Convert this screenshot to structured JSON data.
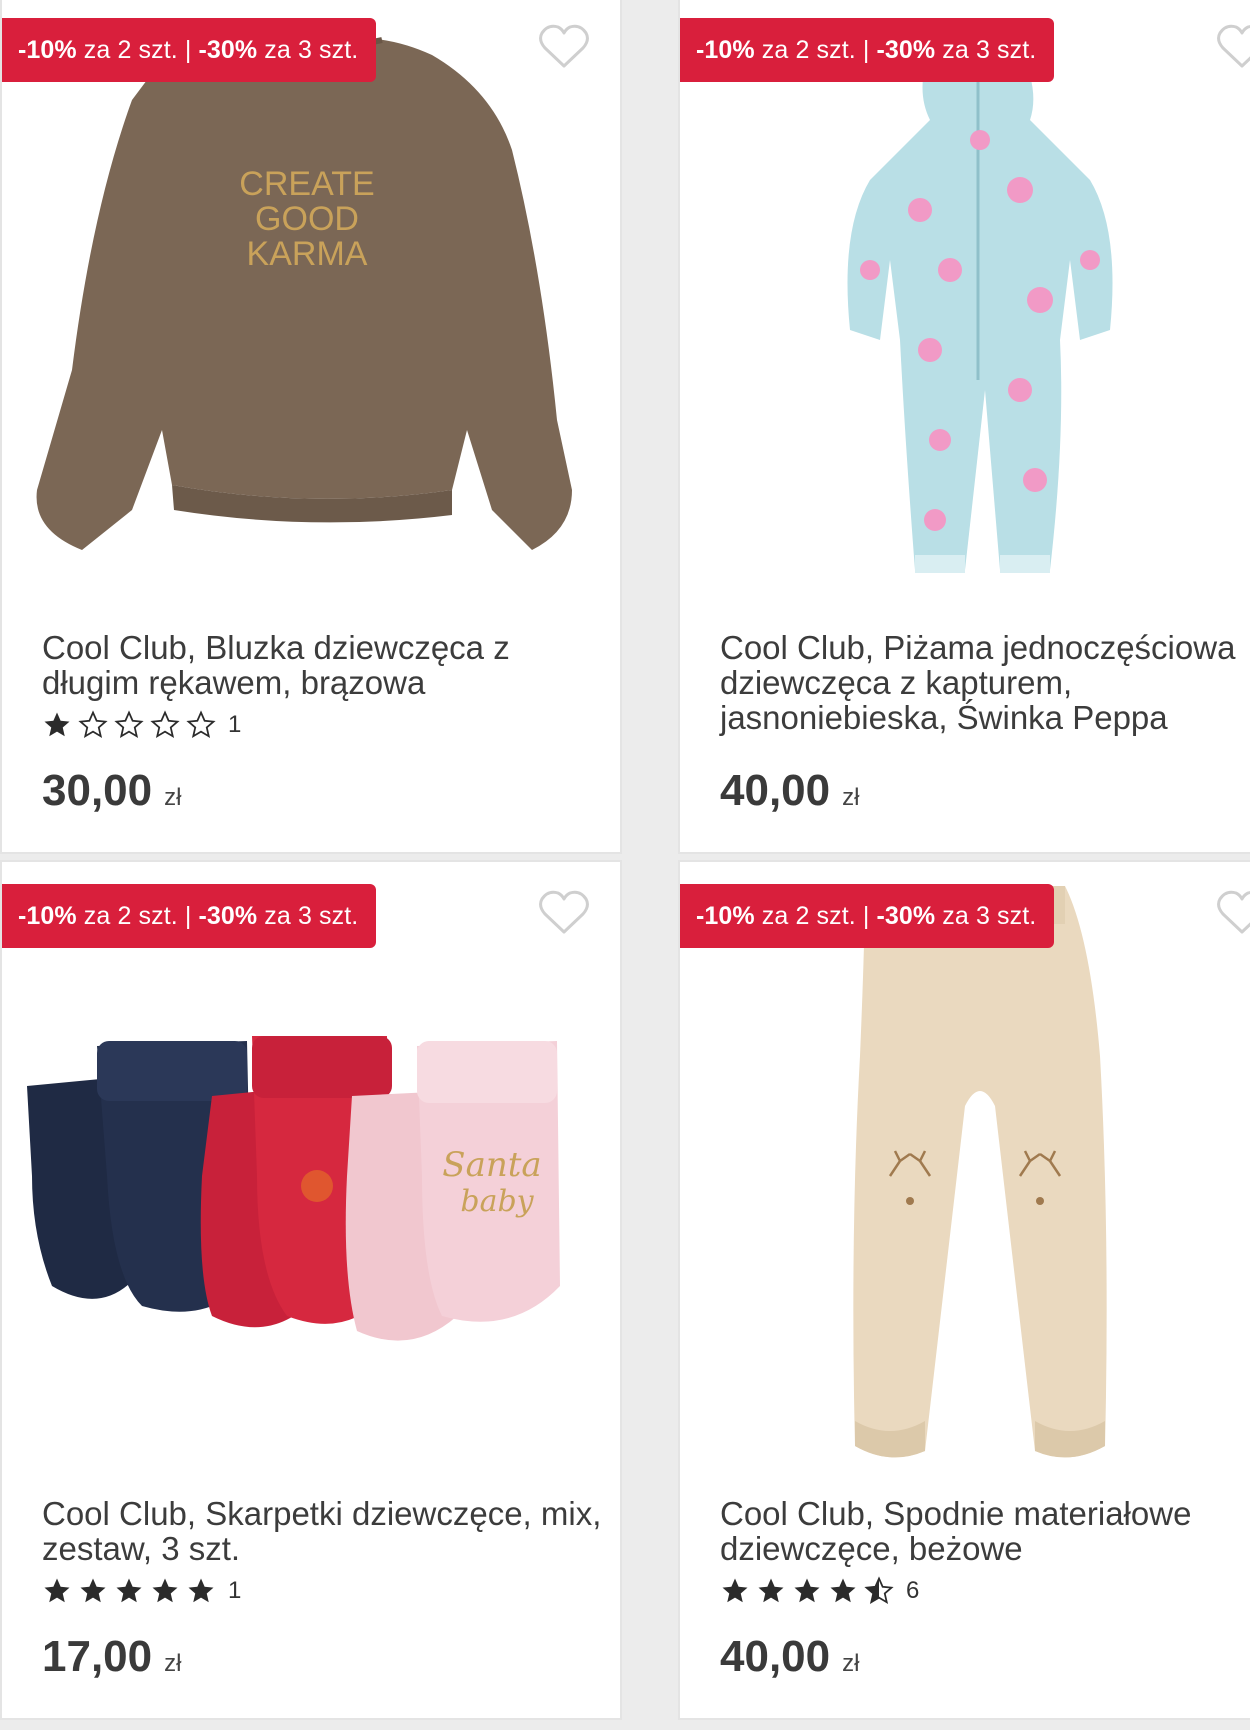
{
  "products": [
    {
      "promo_part1": "-10%",
      "promo_part2": " za 2 szt. | ",
      "promo_part3": "-30%",
      "promo_part4": " za 3 szt.",
      "title": "Cool Club, Bluzka dziewczęca z długim rękawem, brązowa",
      "image_text": [
        "CREATE",
        "GOOD",
        "KARMA"
      ],
      "rating": 1,
      "rating_count": "1",
      "price": "30,00",
      "currency": "zł"
    },
    {
      "promo_part1": "-10%",
      "promo_part2": " za 2 szt. | ",
      "promo_part3": "-30%",
      "promo_part4": " za 3 szt.",
      "title": "Cool Club, Piżama jednoczęściowa dziewczęca z kapturem, jasnoniebieska, Świnka Peppa",
      "price": "40,00",
      "currency": "zł"
    },
    {
      "promo_part1": "-10%",
      "promo_part2": " za 2 szt. | ",
      "promo_part3": "-30%",
      "promo_part4": " za 3 szt.",
      "title": "Cool Club, Skarpetki dziewczęce, mix, zestaw, 3 szt.",
      "image_text": [
        "Santa",
        "baby"
      ],
      "rating": 5,
      "rating_count": "1",
      "price": "17,00",
      "currency": "zł"
    },
    {
      "promo_part1": "-10%",
      "promo_part2": " za 2 szt. | ",
      "promo_part3": "-30%",
      "promo_part4": " za 3 szt.",
      "title": "Cool Club, Spodnie materiałowe dziewczęce, beżowe",
      "rating": 4.5,
      "rating_count": "6",
      "price": "40,00",
      "currency": "zł"
    }
  ],
  "colors": {
    "promo_red": "#d91f3c",
    "star": "#2b2b2b"
  },
  "icons": {
    "wishlist": "heart-outline-icon",
    "rating": "star-icon"
  }
}
